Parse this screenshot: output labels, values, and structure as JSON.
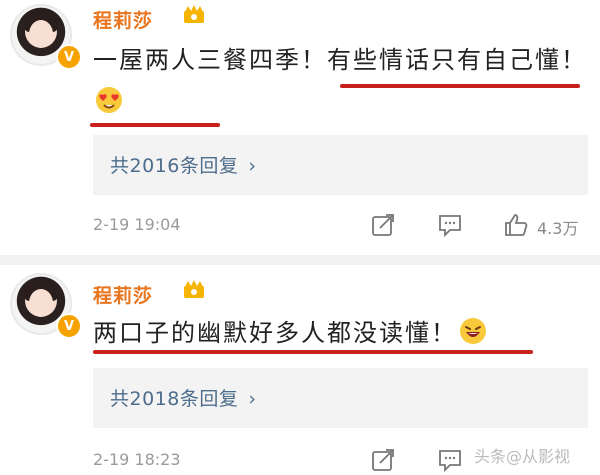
{
  "comments": [
    {
      "author": "程莉莎",
      "text": "一屋两人三餐四季！有些情话只有自己懂！",
      "replies": "共2016条回复",
      "reply_chevron": "›",
      "time": "2-19 19:04",
      "likes": "4.3万",
      "emoji": "heart-eyes-emoji"
    },
    {
      "author": "程莉莎",
      "text": "两口子的幽默好多人都没读懂！",
      "replies": "共2018条回复",
      "reply_chevron": "›",
      "time": "2-19 18:23",
      "likes": "",
      "emoji": "laughing-emoji"
    }
  ],
  "verified_badge": "V",
  "watermark": "头条@从影视",
  "colors": {
    "author": "#e8761f",
    "link": "#4e6d8c",
    "underline": "#c8201a",
    "meta": "#9a9a9a"
  }
}
